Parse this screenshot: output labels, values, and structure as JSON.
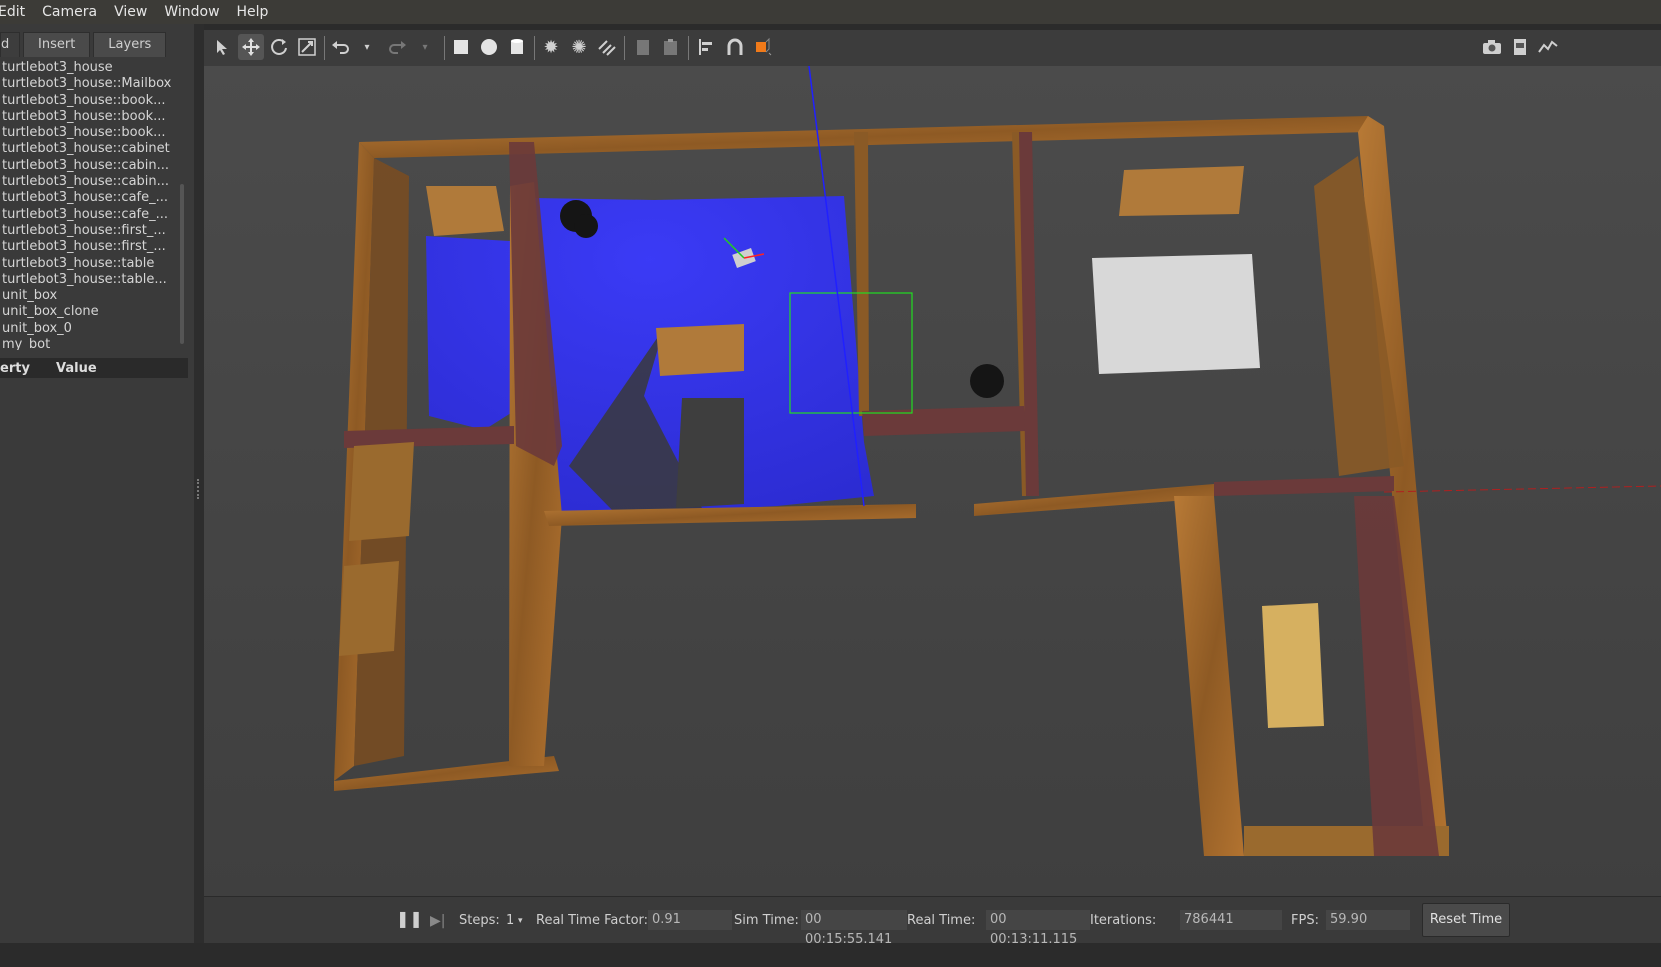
{
  "menu": {
    "edit": "Edit",
    "camera": "Camera",
    "view": "View",
    "window": "Window",
    "help": "Help"
  },
  "left_panel": {
    "tabs": {
      "world": "d",
      "insert": "Insert",
      "layers": "Layers"
    },
    "models": [
      "turtlebot3_house",
      "turtlebot3_house::Mailbox",
      "turtlebot3_house::book...",
      "turtlebot3_house::book...",
      "turtlebot3_house::book...",
      "turtlebot3_house::cabinet",
      "turtlebot3_house::cabin...",
      "turtlebot3_house::cabin...",
      "turtlebot3_house::cafe_...",
      "turtlebot3_house::cafe_...",
      "turtlebot3_house::first_...",
      "turtlebot3_house::first_...",
      "turtlebot3_house::table",
      "turtlebot3_house::table...",
      "unit_box",
      "unit_box_clone",
      "unit_box_0",
      "my_bot"
    ],
    "property_header": {
      "property": "erty",
      "value": "Value"
    }
  },
  "toolbar": {
    "icons": [
      "select-icon",
      "translate-icon",
      "rotate-icon",
      "scale-icon",
      "undo-icon",
      "undo-dropdown-icon",
      "redo-icon",
      "redo-dropdown-icon",
      "box-icon",
      "sphere-icon",
      "cylinder-icon",
      "point-light-icon",
      "spot-light-icon",
      "directional-light-icon",
      "copy-icon",
      "paste-icon",
      "align-icon",
      "snap-icon",
      "view-angle-icon"
    ],
    "right_icons": [
      "screenshot-icon",
      "log-icon",
      "plot-icon"
    ]
  },
  "status": {
    "steps_label": "Steps:",
    "steps_value": "1",
    "rtf_label": "Real Time Factor:",
    "rtf_value": "0.91",
    "sim_label": "Sim Time:",
    "sim_value": "00 00:15:55.141",
    "real_label": "Real Time:",
    "real_value": "00 00:13:11.115",
    "iter_label": "Iterations:",
    "iter_value": "786441",
    "fps_label": "FPS:",
    "fps_value": "59.90",
    "reset_label": "Reset Time"
  },
  "colors": {
    "laser": "#2222ff",
    "wall_wood": "#a0662a",
    "brick": "#6b3a3a",
    "ground": "#454545",
    "selection": "#22dd22"
  }
}
